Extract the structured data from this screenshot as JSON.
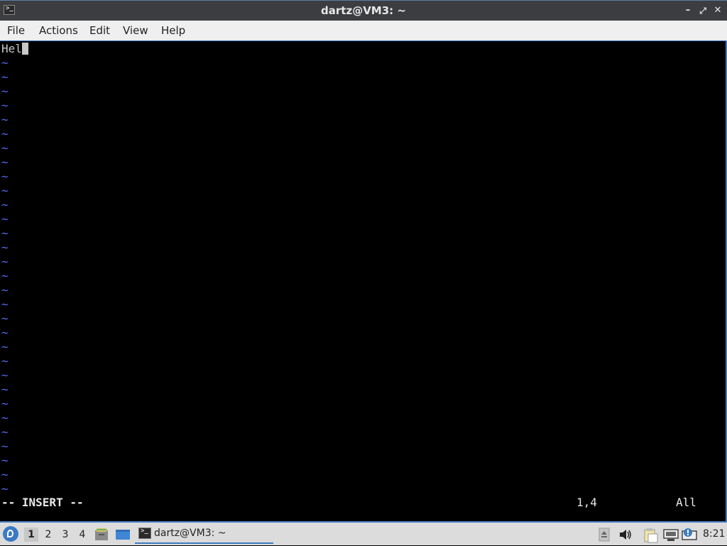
{
  "window": {
    "title": "dartz@VM3: ~",
    "app_icon_glyph": ">_",
    "buttons": {
      "minimize": "–",
      "maximize": "⤢",
      "close": "✕"
    }
  },
  "menu": [
    "File",
    "Actions",
    "Edit",
    "View",
    "Help"
  ],
  "terminal": {
    "first_line_text": "Hel",
    "tilde": "~",
    "tilde_count": 31,
    "mode": "-- INSERT --",
    "position": "1,4",
    "scroll": "All",
    "colors": {
      "text": "#c8c8c8",
      "tilde": "#4f6ff0",
      "background": "#000000"
    }
  },
  "taskbar": {
    "workspaces": [
      "1",
      "2",
      "3",
      "4"
    ],
    "active_workspace": "1",
    "task_label": "dartz@VM3: ~",
    "clock": "8:21",
    "quicklaunch": [
      "file-manager-icon",
      "desktop-icon"
    ],
    "tray": [
      "eject-icon",
      "volume-icon",
      "clipboard-icon",
      "network-icon",
      "update-notifier-icon"
    ],
    "accent": "#3f7cc0"
  }
}
